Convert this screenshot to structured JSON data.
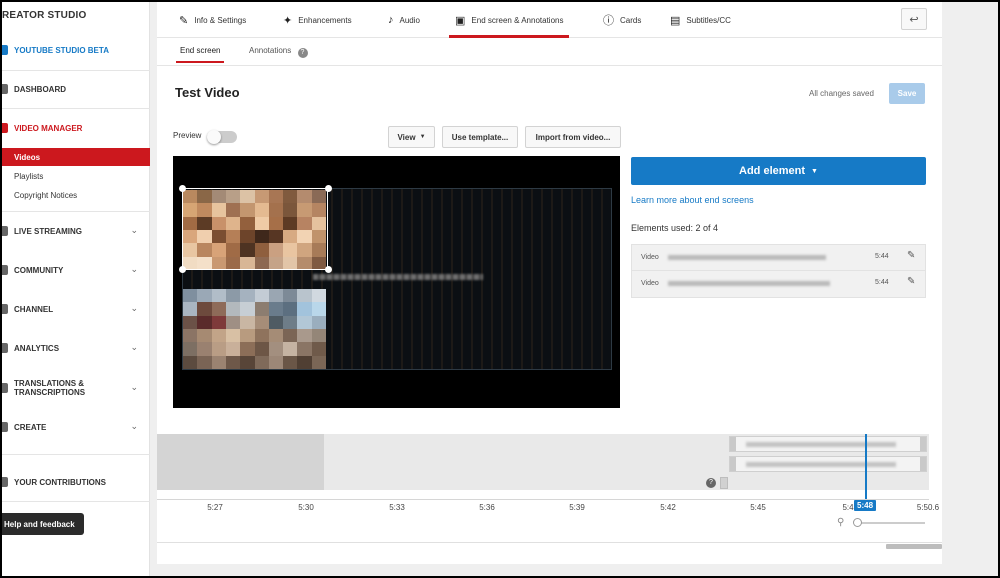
{
  "sidebar": {
    "brand": "REATOR STUDIO",
    "studio_beta": "YOUTUBE STUDIO BETA",
    "dashboard": "DASHBOARD",
    "video_manager": "VIDEO MANAGER",
    "sub": [
      "Videos",
      "Playlists",
      "Copyright Notices"
    ],
    "live_streaming": "LIVE STREAMING",
    "community": "COMMUNITY",
    "channel": "CHANNEL",
    "analytics": "ANALYTICS",
    "translations_line1": "TRANSLATIONS &",
    "translations_line2": "TRANSCRIPTIONS",
    "create": "CREATE",
    "contributions": "YOUR CONTRIBUTIONS",
    "help": "Help and feedback"
  },
  "tabs": {
    "info": "Info & Settings",
    "enhancements": "Enhancements",
    "audio": "Audio",
    "endscreen": "End screen & Annotations",
    "cards": "Cards",
    "subtitles": "Subtitles/CC"
  },
  "subtabs": {
    "endscreen": "End screen",
    "annotations": "Annotations"
  },
  "video": {
    "title": "Test Video",
    "saved": "All changes saved",
    "save": "Save"
  },
  "controls": {
    "preview": "Preview",
    "preview_on": false,
    "view": "View",
    "template": "Use template...",
    "import": "Import from video..."
  },
  "panel": {
    "add_element": "Add element",
    "learn_more": "Learn more about end screens",
    "elements_used": "Elements used: 2 of 4",
    "elements": [
      {
        "type": "Video",
        "duration": "5:44"
      },
      {
        "type": "Video",
        "duration": "5:44"
      }
    ]
  },
  "timeline": {
    "ticks": [
      "5:27",
      "5:30",
      "5:33",
      "5:36",
      "5:39",
      "5:42",
      "5:45",
      "5:4",
      "5:50.6"
    ],
    "current": "5:48"
  },
  "colors": {
    "accent_blue": "#167ac6",
    "accent_red": "#cc181e"
  }
}
